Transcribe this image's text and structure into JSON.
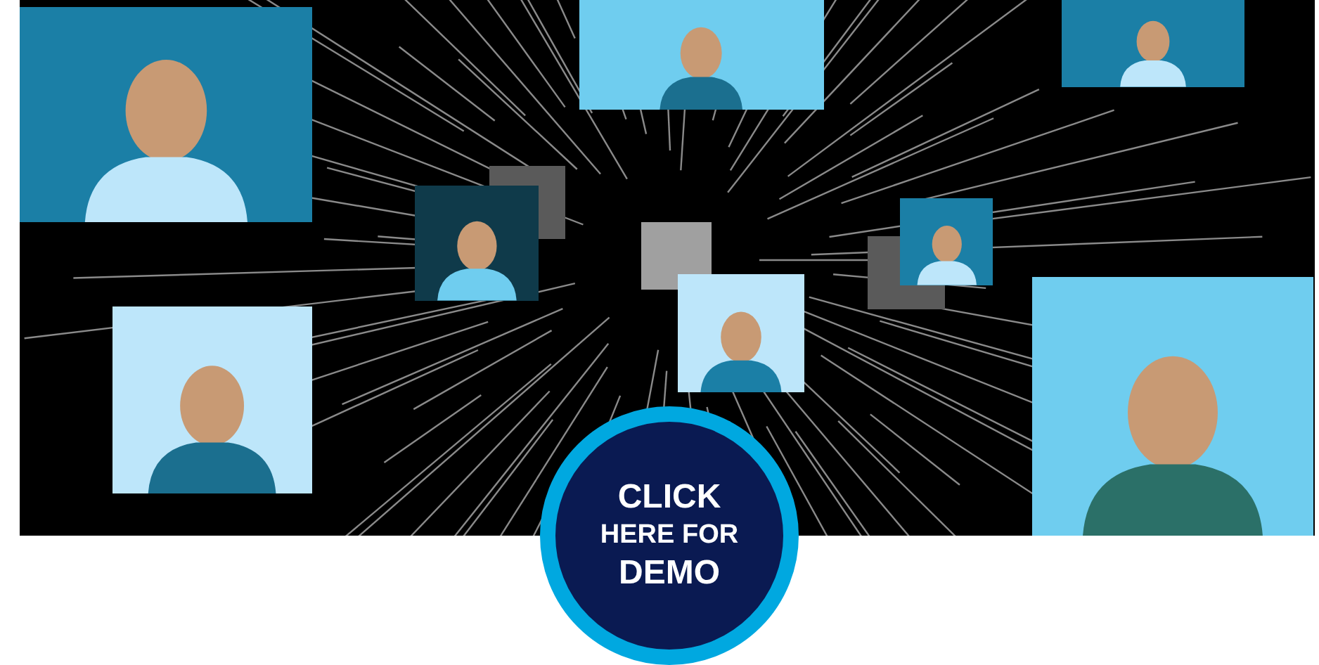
{
  "demo_button": {
    "lines": [
      "CLICK",
      "HERE FOR",
      "DEMO"
    ]
  }
}
